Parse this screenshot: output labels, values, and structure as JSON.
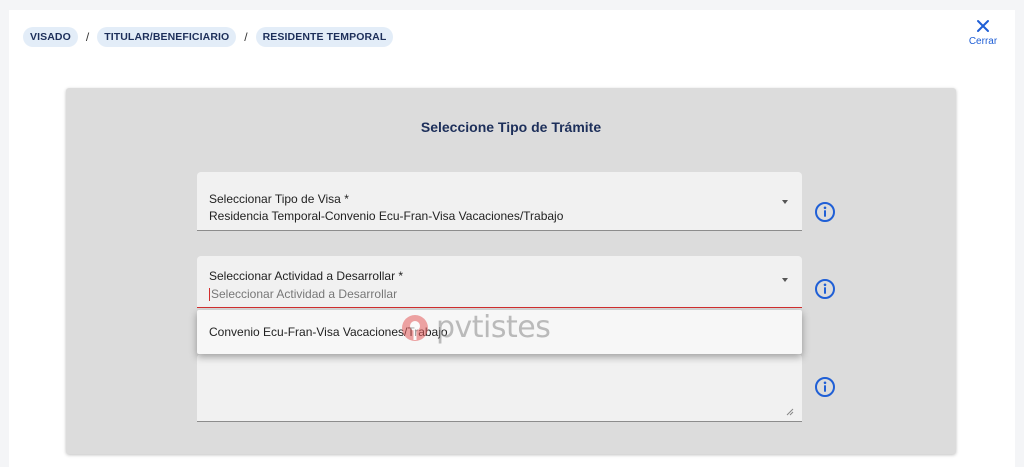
{
  "breadcrumb": {
    "items": [
      "VISADO",
      "TITULAR/BENEFICIARIO",
      "RESIDENTE TEMPORAL"
    ],
    "separator": "/"
  },
  "close": {
    "label": "Cerrar",
    "icon": "close-icon"
  },
  "form": {
    "title": "Seleccione Tipo de Trámite",
    "visa_field": {
      "label": "Seleccionar Tipo de Visa *",
      "value": "Residencia Temporal-Convenio Ecu-Fran-Visa Vacaciones/Trabajo"
    },
    "activity_field": {
      "label": "Seleccionar Actividad a Desarrollar *",
      "placeholder": "Seleccionar Actividad a Desarrollar"
    },
    "dropdown_options": [
      "Convenio Ecu-Fran-Visa Vacaciones/Trabajo"
    ]
  },
  "watermark": {
    "text": "pvtistes"
  },
  "colors": {
    "accent": "#1f5fd6",
    "breadcrumb_bg": "#e3edf8",
    "error": "#d32f2f",
    "panel_bg": "#dcdcdc",
    "title": "#1d2f5a"
  }
}
